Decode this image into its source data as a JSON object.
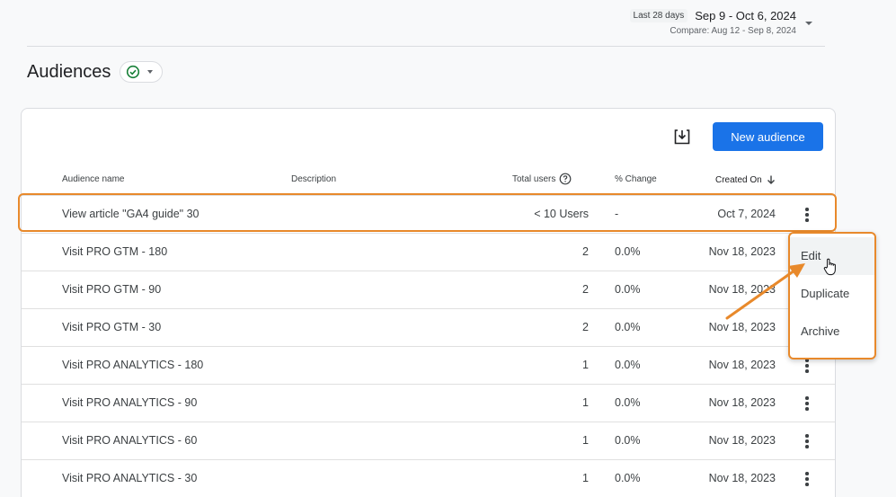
{
  "date_range": {
    "tag": "Last 28 days",
    "range": "Sep 9 - Oct 6, 2024",
    "compare": "Compare: Aug 12 - Sep 8, 2024"
  },
  "page": {
    "title": "Audiences"
  },
  "toolbar": {
    "new_audience_label": "New audience"
  },
  "table": {
    "headers": {
      "name": "Audience name",
      "description": "Description",
      "users": "Total users",
      "change": "% Change",
      "created": "Created On"
    },
    "rows": [
      {
        "name": "View article \"GA4 guide\" 30",
        "users": "< 10 Users",
        "change": "-",
        "created": "Oct 7, 2024"
      },
      {
        "name": "Visit PRO GTM - 180",
        "users": "2",
        "change": "0.0%",
        "created": "Nov 18, 2023"
      },
      {
        "name": "Visit PRO GTM - 90",
        "users": "2",
        "change": "0.0%",
        "created": "Nov 18, 2023"
      },
      {
        "name": "Visit PRO GTM - 30",
        "users": "2",
        "change": "0.0%",
        "created": "Nov 18, 2023"
      },
      {
        "name": "Visit PRO ANALYTICS - 180",
        "users": "1",
        "change": "0.0%",
        "created": "Nov 18, 2023"
      },
      {
        "name": "Visit PRO ANALYTICS - 90",
        "users": "1",
        "change": "0.0%",
        "created": "Nov 18, 2023"
      },
      {
        "name": "Visit PRO ANALYTICS - 60",
        "users": "1",
        "change": "0.0%",
        "created": "Nov 18, 2023"
      },
      {
        "name": "Visit PRO ANALYTICS - 30",
        "users": "1",
        "change": "0.0%",
        "created": "Nov 18, 2023"
      }
    ]
  },
  "context_menu": {
    "items": [
      "Edit",
      "Duplicate",
      "Archive"
    ]
  },
  "colors": {
    "primary": "#1a73e8",
    "highlight": "#e8892b",
    "success": "#188038"
  },
  "icons": {
    "status": "check-circle-icon",
    "download": "download-icon",
    "help": "help-icon",
    "sort": "arrow-down-icon",
    "menu": "more-vert-icon",
    "cursor": "hand-pointer-icon"
  }
}
